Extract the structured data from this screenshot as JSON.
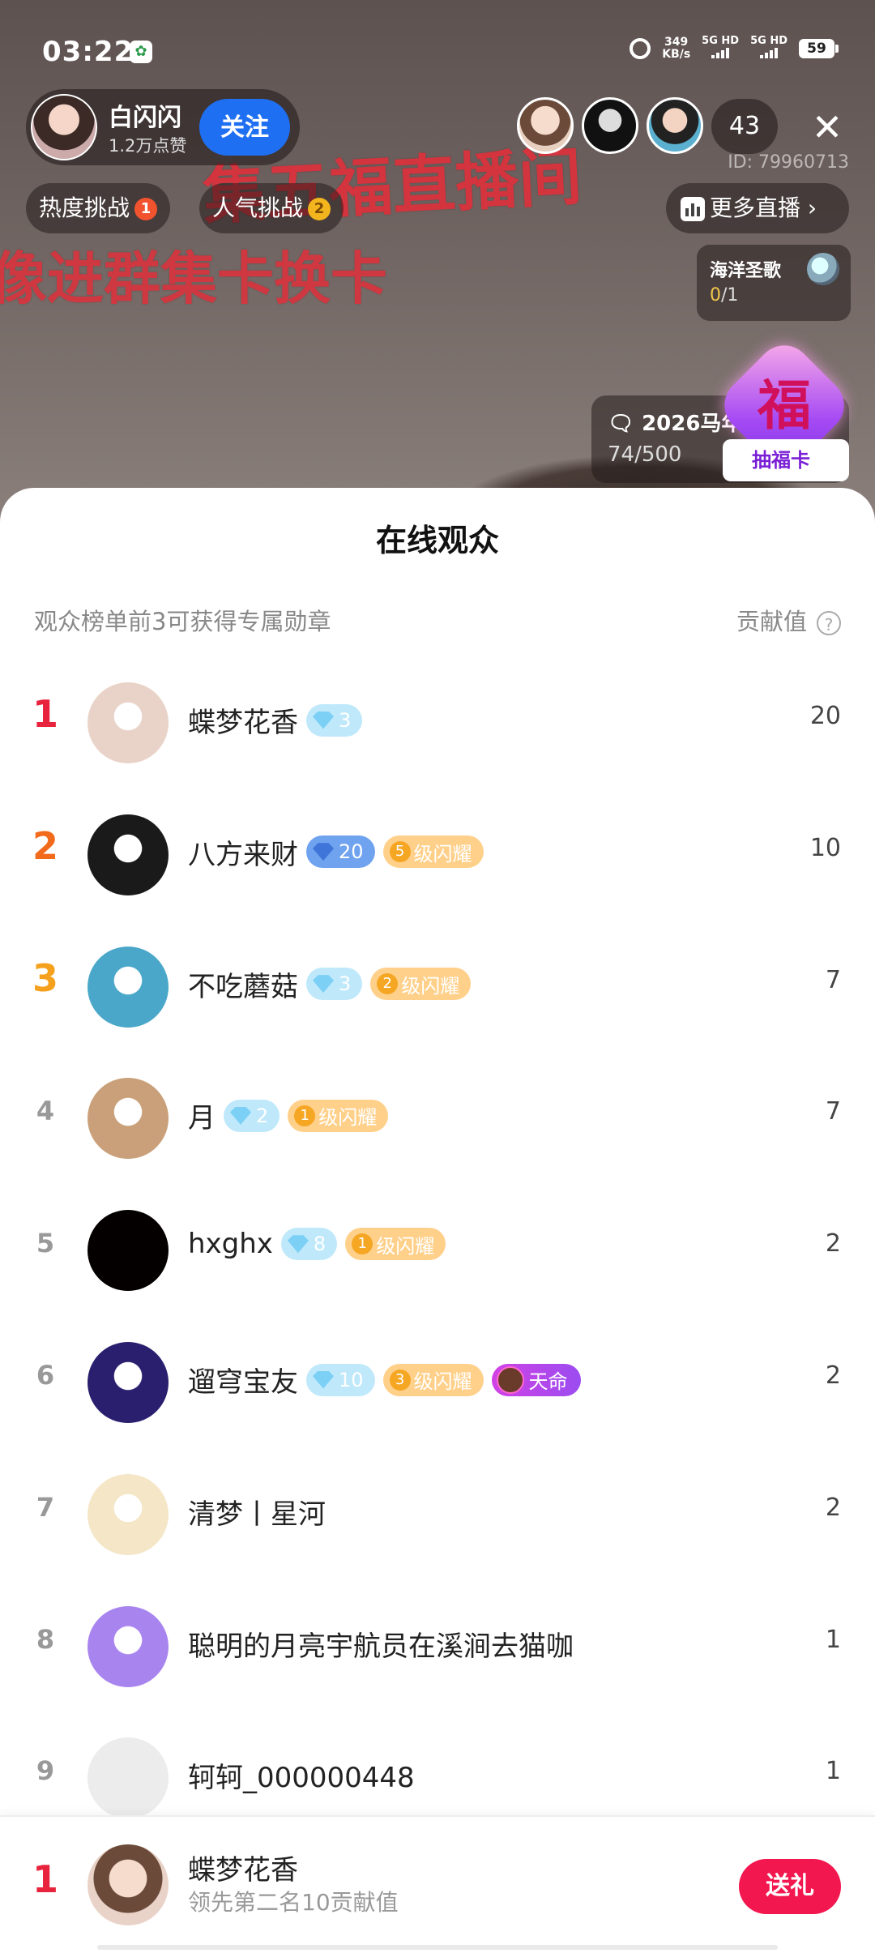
{
  "status_bar": {
    "time": "03:22",
    "net_speed_value": "349",
    "net_speed_unit": "KB/s",
    "sim1": "5G HD",
    "sim2": "5G HD",
    "battery": "59"
  },
  "host": {
    "name": "白闪闪",
    "likes": "1.2万点赞",
    "follow_label": "关注"
  },
  "viewer_count": "43",
  "room_id": "ID: 79960713",
  "background_text": {
    "title": "集五福直播间",
    "subtitle": "像进群集卡换卡"
  },
  "challenges": [
    {
      "label": "热度挑战",
      "num": "1",
      "color": "#f2532f"
    },
    {
      "label": "人气挑战",
      "num": "2",
      "color": "#f3b51e"
    }
  ],
  "more_live_label": "更多直播",
  "gift_card": {
    "title": "海洋圣歌",
    "progress_current": "0",
    "progress_total": "/1"
  },
  "task_card": {
    "title": "2026马年集",
    "progress": "74/500"
  },
  "fu_badge": {
    "char": "福",
    "button": "抽福卡"
  },
  "sheet": {
    "title": "在线观众",
    "tip": "观众榜单前3可获得专属勋章",
    "contrib_header": "贡献值",
    "help_icon": "?"
  },
  "viewers": [
    {
      "rank": "1",
      "name": "蝶梦花香",
      "level": "3",
      "level_style": "light",
      "shine": "",
      "fate": "",
      "score": "20",
      "rank_color": "#e8233e",
      "avatar_color": "#e9d3c8"
    },
    {
      "rank": "2",
      "name": "八方来财",
      "level": "20",
      "level_style": "blue",
      "shine": "5",
      "shine_text": "级闪耀",
      "fate": "",
      "score": "10",
      "rank_color": "#f26b1d",
      "avatar_color": "#1a1a1a"
    },
    {
      "rank": "3",
      "name": "不吃蘑菇",
      "level": "3",
      "level_style": "light",
      "shine": "2",
      "shine_text": "级闪耀",
      "fate": "",
      "score": "7",
      "rank_color": "#f5a11d",
      "avatar_color": "#4aa7c9"
    },
    {
      "rank": "4",
      "name": "月",
      "level": "2",
      "level_style": "light",
      "shine": "1",
      "shine_text": "级闪耀",
      "fate": "",
      "score": "7",
      "rank_color": "#999999",
      "avatar_color": "#c9a07a"
    },
    {
      "rank": "5",
      "name": "hxghx",
      "level": "8",
      "level_style": "light",
      "shine": "1",
      "shine_text": "级闪耀",
      "fate": "",
      "score": "2",
      "rank_color": "#999999",
      "avatar_color": "#050000"
    },
    {
      "rank": "6",
      "name": "遛穹宝友",
      "level": "10",
      "level_style": "light",
      "shine": "3",
      "shine_text": "级闪耀",
      "fate": "天命",
      "score": "2",
      "rank_color": "#999999",
      "avatar_color": "#2a1f6e"
    },
    {
      "rank": "7",
      "name": "清梦丨星河",
      "level": "",
      "level_style": "",
      "shine": "",
      "fate": "",
      "score": "2",
      "rank_color": "#999999",
      "avatar_color": "#f4e6c6"
    },
    {
      "rank": "8",
      "name": "聪明的月亮宇航员在溪涧去猫咖",
      "level": "",
      "level_style": "",
      "shine": "",
      "fate": "",
      "score": "1",
      "rank_color": "#999999",
      "avatar_color": "#a884ee"
    },
    {
      "rank": "9",
      "name": "轲轲_000000448",
      "level": "",
      "level_style": "",
      "shine": "",
      "fate": "",
      "score": "1",
      "rank_color": "#999999",
      "avatar_color": "#ececec"
    }
  ],
  "pinned": {
    "rank": "1",
    "name": "蝶梦花香",
    "subtitle": "领先第二名10贡献值",
    "gift_button": "送礼",
    "rank_color": "#e8233e"
  }
}
